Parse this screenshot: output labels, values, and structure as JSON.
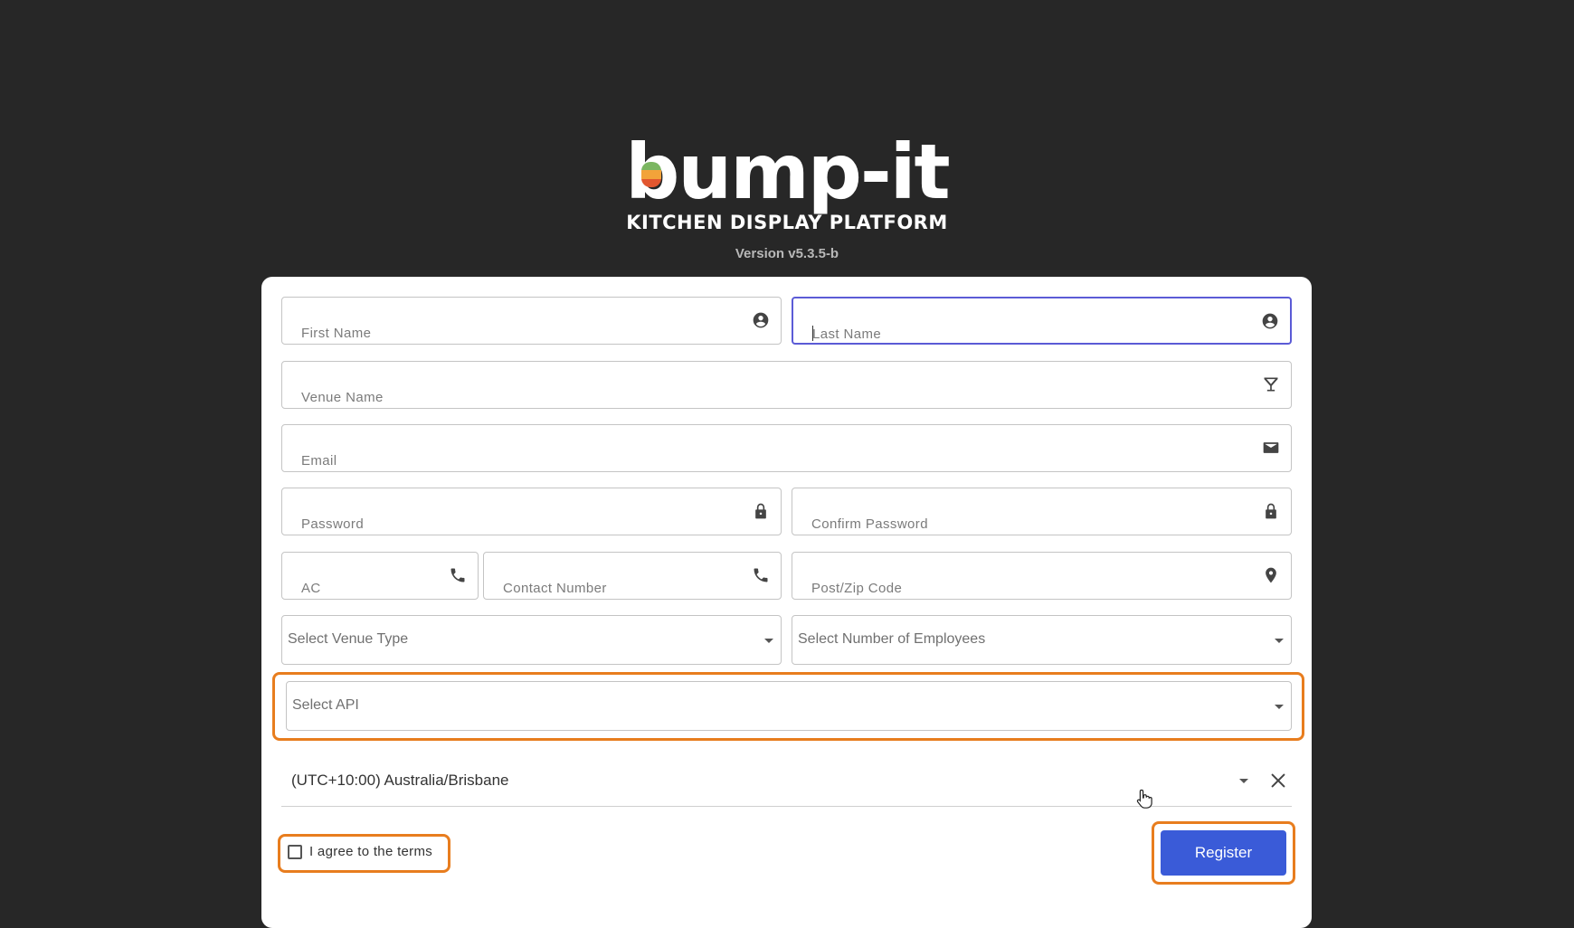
{
  "brand": {
    "logo_text": "bump-it",
    "tagline": "KITCHEN DISPLAY PLATFORM",
    "version": "Version v5.3.5-b",
    "logo_colors": [
      "#7bb661",
      "#f2a33a",
      "#e2572f"
    ]
  },
  "form": {
    "first_name": {
      "placeholder": "First Name",
      "icon": "account-circle-icon"
    },
    "last_name": {
      "placeholder": "Last Name",
      "icon": "account-circle-icon",
      "focused": true
    },
    "venue_name": {
      "placeholder": "Venue Name",
      "icon": "cocktail-glass-icon"
    },
    "email": {
      "placeholder": "Email",
      "icon": "envelope-icon"
    },
    "password": {
      "placeholder": "Password",
      "icon": "lock-icon"
    },
    "confirm_password": {
      "placeholder": "Confirm Password",
      "icon": "lock-icon"
    },
    "area_code": {
      "placeholder": "AC",
      "icon": "phone-icon"
    },
    "contact_number": {
      "placeholder": "Contact Number",
      "icon": "phone-icon"
    },
    "postcode": {
      "placeholder": "Post/Zip Code",
      "icon": "location-pin-icon"
    },
    "venue_type": {
      "placeholder": "Select Venue Type"
    },
    "employees": {
      "placeholder": "Select Number of Employees"
    },
    "api": {
      "placeholder": "Select API"
    },
    "timezone": {
      "value": "(UTC+10:00) Australia/Brisbane"
    },
    "terms_label": "I agree to the terms",
    "terms_checked": false,
    "register_label": "Register"
  },
  "colors": {
    "background": "#272727",
    "card": "#ffffff",
    "focus_border": "#5b5bd6",
    "highlight": "#e87d1e",
    "primary_button": "#3a5bd8"
  }
}
